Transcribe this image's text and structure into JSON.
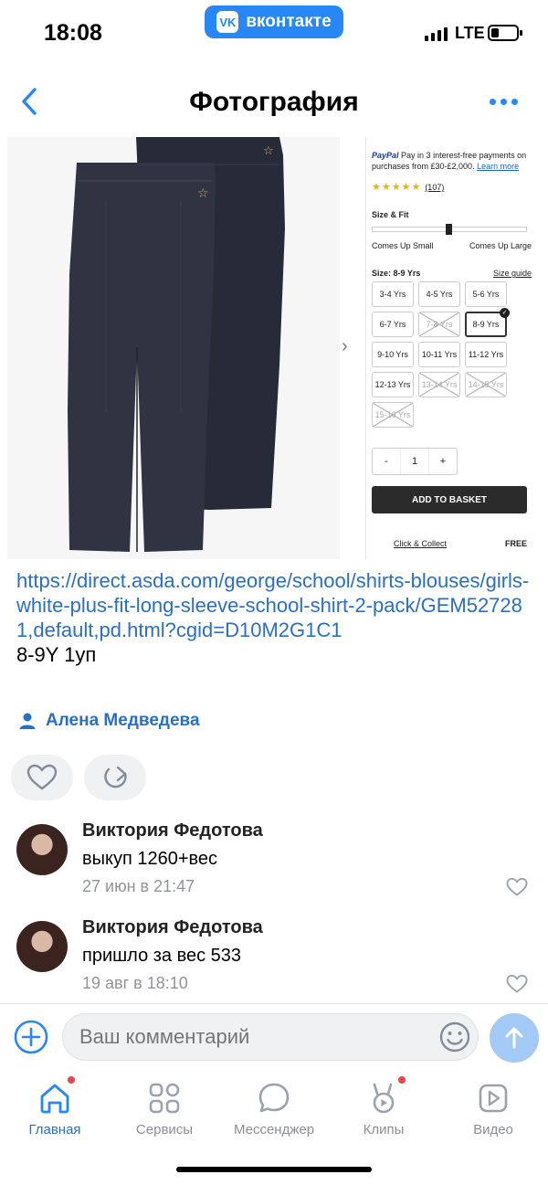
{
  "status_bar": {
    "time": "18:08",
    "carrier_app": "вконтакте",
    "carrier_logo": "VK",
    "network": "LTE"
  },
  "nav": {
    "title": "Фотография"
  },
  "photo": {
    "paypal_brand": "PayPal",
    "paypal_text": "Pay in 3 interest-free payments on purchases from £30-£2,000.",
    "paypal_link": "Learn more",
    "rating_stars": "★★★★★",
    "rating_count": "(107)",
    "size_fit_label": "Size & Fit",
    "fit_small": "Comes Up Small",
    "fit_large": "Comes Up Large",
    "size_label": "Size: 8-9 Yrs",
    "size_guide": "Size guide",
    "sizes": [
      {
        "label": "3-4 Yrs",
        "state": "available"
      },
      {
        "label": "4-5 Yrs",
        "state": "available"
      },
      {
        "label": "5-6 Yrs",
        "state": "available"
      },
      {
        "label": "6-7 Yrs",
        "state": "available"
      },
      {
        "label": "7-8 Yrs",
        "state": "unavailable"
      },
      {
        "label": "8-9 Yrs",
        "state": "selected"
      },
      {
        "label": "9-10 Yrs",
        "state": "available"
      },
      {
        "label": "10-11 Yrs",
        "state": "available"
      },
      {
        "label": "11-12 Yrs",
        "state": "available"
      },
      {
        "label": "12-13 Yrs",
        "state": "available"
      },
      {
        "label": "13-14 Yrs",
        "state": "unavailable"
      },
      {
        "label": "14-15 Yrs",
        "state": "unavailable"
      },
      {
        "label": "15-16 Yrs",
        "state": "unavailable"
      }
    ],
    "qty_minus": "-",
    "qty_value": "1",
    "qty_plus": "+",
    "basket_label": "ADD TO BASKET",
    "collect_label": "Click & Collect",
    "collect_price": "FREE"
  },
  "post": {
    "link": "https://direct.asda.com/george/school/shirts-blouses/girls-white-plus-fit-long-sleeve-school-shirt-2-pack/GEM527281,default,pd.html?cgid=D10M2G1C1",
    "note": "8-9Y 1уп",
    "author": "Алена Медведева"
  },
  "comments": [
    {
      "name": "Виктория Федотова",
      "text": "выкуп 1260+вес",
      "date": "27 июн в 21:47"
    },
    {
      "name": "Виктория Федотова",
      "text": "пришло за вес 533",
      "date": "19 авг в 18:10"
    }
  ],
  "comment_input": {
    "placeholder": "Ваш комментарий"
  },
  "tabs": [
    {
      "label": "Главная",
      "icon": "home-icon",
      "active": true,
      "badge": true
    },
    {
      "label": "Сервисы",
      "icon": "services-icon",
      "active": false,
      "badge": false
    },
    {
      "label": "Мессенджер",
      "icon": "messenger-icon",
      "active": false,
      "badge": false
    },
    {
      "label": "Клипы",
      "icon": "clips-icon",
      "active": false,
      "badge": true
    },
    {
      "label": "Видео",
      "icon": "video-icon",
      "active": false,
      "badge": false
    }
  ],
  "colors": {
    "accent": "#2787f5",
    "link": "#2a6fc0",
    "muted": "#909499",
    "badge": "#e64646",
    "send_disabled": "#a3c9f5"
  }
}
